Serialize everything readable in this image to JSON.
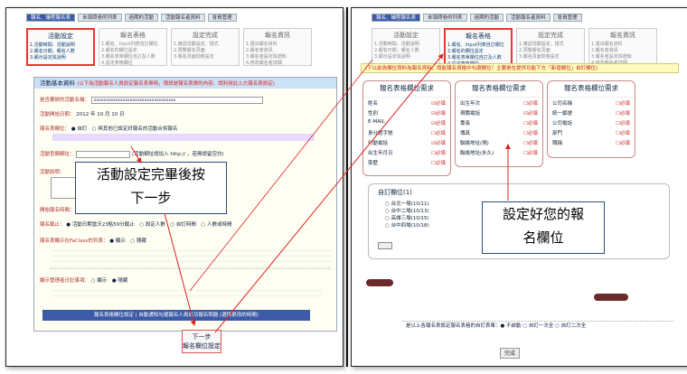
{
  "left": {
    "tabs": [
      "報名、議程報名表",
      "未填問卷的列表",
      "過期的活動",
      "活動報名者資料",
      "會員管理"
    ],
    "steps": [
      {
        "title": "活動設定",
        "lines": [
          "1.活動時間、活動說明",
          "2.報名日期、報名人數",
          "3.顯示設定與說明"
        ]
      },
      {
        "title": "報名表格",
        "lines": [
          "1.報名、Input列表自訂欄位",
          "2.報名的欄位設定",
          "3.報名表單欄位自訂及人數",
          "4.設定表格欄位"
        ]
      },
      {
        "title": "設定完成",
        "lines": [
          "1.確認活動設定、樣式",
          "2.預覽報名頁面",
          "3.報名頁面問卷設定"
        ]
      },
      {
        "title": "報名資訊",
        "lines": [
          "1.匯出報名資料",
          "2.報名者資訊",
          "3.報名者設定與通知",
          "4.修改報名者詳細"
        ]
      }
    ],
    "panel_title": "活動基本資料",
    "panel_note": "(以下為活動報名人員設定報名表單時，預設是報名表單的內容、請利用此上方報名表設定)",
    "rows": [
      {
        "k": "是否要辦的活動名稱：",
        "v": "xxxxxxxxxxxxxxxxxxxxxxxxxxxxxxxxxx"
      },
      {
        "k": "活動開始日期：",
        "v": "2012 年 10 月 10 日"
      },
      {
        "k": "報名表欄位：",
        "v": "● 自訂　○ 與其他已設定好報名的活動合併報名"
      },
      {
        "k": "活動官網網址：",
        "v": "(活動網址請加入 http:// ，若無請留空白)"
      },
      {
        "k": "活動說明：",
        "v": ""
      },
      {
        "k": "開始報名時間：",
        "v": ""
      },
      {
        "k": "報名截止：",
        "v": "● 活動日期當天23點59分截止　○ 設定人數　○ 自訂時間　○ 人數或時間"
      },
      {
        "k": "報名表顯示在FaClass的列表：",
        "v": "● 顯示　○ 隱藏"
      },
      {
        "k": "顯示管理者日記事項：",
        "v": "○ 顯示　● 隱藏"
      }
    ],
    "blue_bar": "報名表格欄位設定 | 自動通知勾選報名人員成功報名問題 (選擇更改的時間)",
    "next_button": [
      "下一步",
      "報名欄位設定"
    ],
    "callout": [
      "活動設定完畢後按",
      "下一步"
    ]
  },
  "right": {
    "tabs": [
      "報名、議程報名表",
      "未填問卷的列表",
      "過期的活動",
      "活動報名者資料",
      "會員管理"
    ],
    "notice": "(下以前為欄位資料為報名資料，請能報名資格中勾選欄位！主要是在提供功能下方「新增欄位」自訂欄位)",
    "columns": [
      {
        "title": "報名表格欄位需求",
        "items": [
          "姓名",
          "性別",
          "E-MAIL",
          "身分證字號",
          "行動電話",
          "出生年月日",
          "學歷"
        ]
      },
      {
        "title": "報名表格欄位需求",
        "items": [
          "出生年次",
          "現職電話",
          "專長",
          "傳真",
          "聯絡地址(現)",
          "聯絡地址(永久)"
        ]
      },
      {
        "title": "報名表格欄位需求",
        "items": [
          "公司名稱",
          "統一編號",
          "公司電話",
          "部門",
          "職稱"
        ]
      }
    ],
    "custom_title": "自訂欄位(1)",
    "custom_items": [
      "台北一場(10/11)",
      "台中二場(10/13)",
      "高雄三場(10/15)",
      "台中四場(10/18)"
    ],
    "bottom_bar": "是以上各報名表設定報名表格的自訂表單：● 不啟動 ○ 自訂一次全 ○ 自訂二次全",
    "done_button": "完成",
    "callout": [
      "設定好您的報",
      "名欄位"
    ]
  }
}
